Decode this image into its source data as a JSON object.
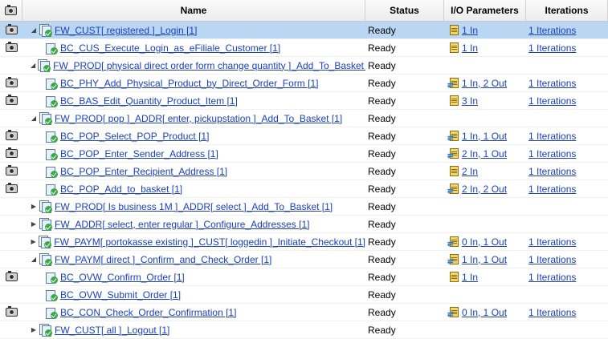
{
  "columns": {
    "name": "Name",
    "status": "Status",
    "io": "I/O Parameters",
    "iterations": "Iterations"
  },
  "rows": [
    {
      "name": "FW_CUST[ registered ]_Login [1]",
      "level": 0,
      "expand": "open",
      "camera": true,
      "status": "Ready",
      "io": "1 In",
      "io_arrows": false,
      "iterations": "1 Iterations",
      "selected": true
    },
    {
      "name": "BC_CUS_Execute_Login_as_eFiliale_Customer [1]",
      "level": 1,
      "expand": "none",
      "camera": true,
      "status": "Ready",
      "io": "1 In",
      "io_arrows": false,
      "iterations": "1 Iterations",
      "selected": false
    },
    {
      "name": "FW_PROD[ physical direct order form change quantity ]_Add_To_Basket [1]",
      "level": 0,
      "expand": "open",
      "camera": false,
      "status": "Ready",
      "io": "",
      "io_arrows": false,
      "iterations": "",
      "selected": false
    },
    {
      "name": "BC_PHY_Add_Physical_Product_by_Direct_Order_Form [1]",
      "level": 1,
      "expand": "none",
      "camera": true,
      "status": "Ready",
      "io": "1 In, 2 Out",
      "io_arrows": true,
      "iterations": "1 Iterations",
      "selected": false
    },
    {
      "name": "BC_BAS_Edit_Quantity_Product_Item [1]",
      "level": 1,
      "expand": "none",
      "camera": true,
      "status": "Ready",
      "io": "3 In",
      "io_arrows": false,
      "iterations": "1 Iterations",
      "selected": false
    },
    {
      "name": "FW_PROD[ pop ]_ADDR[ enter, pickupstation ]_Add_To_Basket [1]",
      "level": 0,
      "expand": "open",
      "camera": false,
      "status": "Ready",
      "io": "",
      "io_arrows": false,
      "iterations": "",
      "selected": false
    },
    {
      "name": "BC_POP_Select_POP_Product [1]",
      "level": 1,
      "expand": "none",
      "camera": true,
      "status": "Ready",
      "io": "1 In, 1 Out",
      "io_arrows": true,
      "iterations": "1 Iterations",
      "selected": false
    },
    {
      "name": "BC_POP_Enter_Sender_Address [1]",
      "level": 1,
      "expand": "none",
      "camera": true,
      "status": "Ready",
      "io": "2 In, 1 Out",
      "io_arrows": true,
      "iterations": "1 Iterations",
      "selected": false
    },
    {
      "name": "BC_POP_Enter_Recipient_Address [1]",
      "level": 1,
      "expand": "none",
      "camera": true,
      "status": "Ready",
      "io": "2 In",
      "io_arrows": false,
      "iterations": "1 Iterations",
      "selected": false
    },
    {
      "name": "BC_POP_Add_to_basket [1]",
      "level": 1,
      "expand": "none",
      "camera": true,
      "status": "Ready",
      "io": "2 In, 2 Out",
      "io_arrows": true,
      "iterations": "1 Iterations",
      "selected": false
    },
    {
      "name": "FW_PROD[ Is business 1M ]_ADDR[ select ]_Add_To_Basket [1]",
      "level": 0,
      "expand": "closed",
      "camera": false,
      "status": "Ready",
      "io": "",
      "io_arrows": false,
      "iterations": "",
      "selected": false
    },
    {
      "name": "FW_ADDR[ select, enter regular ]_Configure_Addresses [1]",
      "level": 0,
      "expand": "closed",
      "camera": false,
      "status": "Ready",
      "io": "",
      "io_arrows": false,
      "iterations": "",
      "selected": false
    },
    {
      "name": "FW_PAYM[ portokasse existing ]_CUST[ loggedin ]_Initiate_Checkout [1]",
      "level": 0,
      "expand": "closed",
      "camera": false,
      "status": "Ready",
      "io": "0 In, 1 Out",
      "io_arrows": true,
      "iterations": "1 Iterations",
      "selected": false
    },
    {
      "name": "FW_PAYM[ direct ]_Confirm_and_Check_Order [1]",
      "level": 0,
      "expand": "open",
      "camera": false,
      "status": "Ready",
      "io": "1 In, 1 Out",
      "io_arrows": true,
      "iterations": "1 Iterations",
      "selected": false
    },
    {
      "name": "BC_OVW_Confirm_Order [1]",
      "level": 1,
      "expand": "none",
      "camera": true,
      "status": "Ready",
      "io": "1 In",
      "io_arrows": false,
      "iterations": "1 Iterations",
      "selected": false
    },
    {
      "name": "BC_OVW_Submit_Order [1]",
      "level": 1,
      "expand": "none",
      "camera": false,
      "status": "Ready",
      "io": "",
      "io_arrows": false,
      "iterations": "",
      "selected": false
    },
    {
      "name": "BC_CON_Check_Order_Confirmation [1]",
      "level": 1,
      "expand": "none",
      "camera": true,
      "status": "Ready",
      "io": "0 In, 1 Out",
      "io_arrows": true,
      "iterations": "1 Iterations",
      "selected": false
    },
    {
      "name": "FW_CUST[ all ]_Logout [1]",
      "level": 0,
      "expand": "closed",
      "camera": false,
      "status": "Ready",
      "io": "",
      "io_arrows": false,
      "iterations": "",
      "selected": false
    }
  ]
}
